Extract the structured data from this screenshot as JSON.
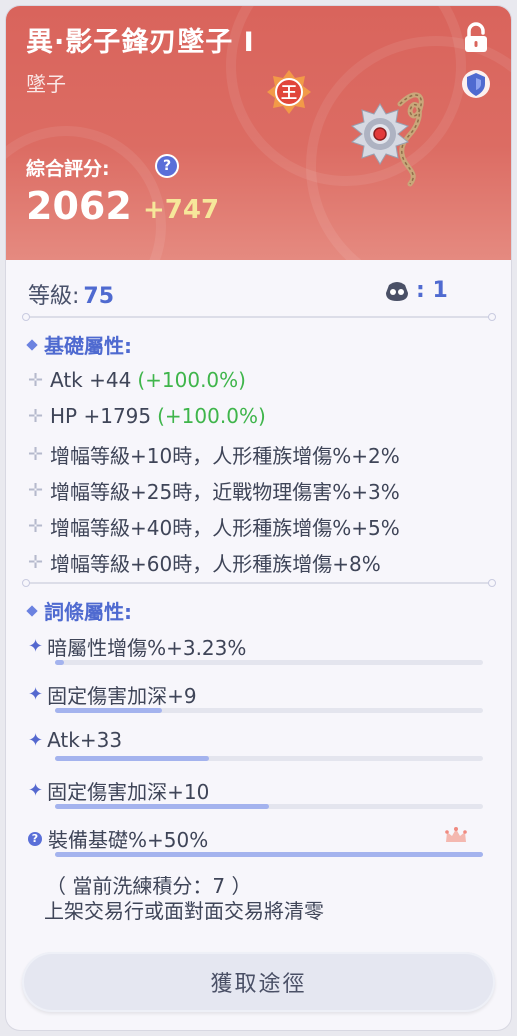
{
  "header": {
    "title": "異·影子鋒刃墜子 I",
    "subtitle": "墜子",
    "rating_label": "綜合評分:",
    "rating_value": "2062",
    "rating_bonus": "+747",
    "badge_glyph": "王",
    "accent": "#d9645c"
  },
  "level": {
    "label": "等級:",
    "value": "75",
    "slots": ": 1"
  },
  "base_section": {
    "title": "基礎屬性:",
    "stats": [
      {
        "text": "Atk +44",
        "bonus": "(+100.0%)"
      },
      {
        "text": "HP +1795",
        "bonus": "(+100.0%)"
      },
      {
        "text": "增幅等級+10時，人形種族增傷%+2%"
      },
      {
        "text": "增幅等級+25時，近戰物理傷害%+3%"
      },
      {
        "text": "增幅等級+40時，人形種族增傷%+5%"
      },
      {
        "text": "增幅等級+60時，人形種族增傷+8%"
      }
    ]
  },
  "affix_section": {
    "title": "詞條屬性:",
    "affixes": [
      {
        "text": "暗屬性增傷%+3.23%",
        "fill": 0.02
      },
      {
        "text": "固定傷害加深+9",
        "fill": 0.25
      },
      {
        "text": "Atk+33",
        "fill": 0.36
      },
      {
        "text": "固定傷害加深+10",
        "fill": 0.5
      },
      {
        "text": "裝備基礎%+50%",
        "fill": 1.0
      }
    ]
  },
  "note": {
    "line1": "（ 當前洗練積分：7 ）",
    "line2": "上架交易行或面對面交易將清零"
  },
  "button": {
    "label": "獲取途徑"
  }
}
